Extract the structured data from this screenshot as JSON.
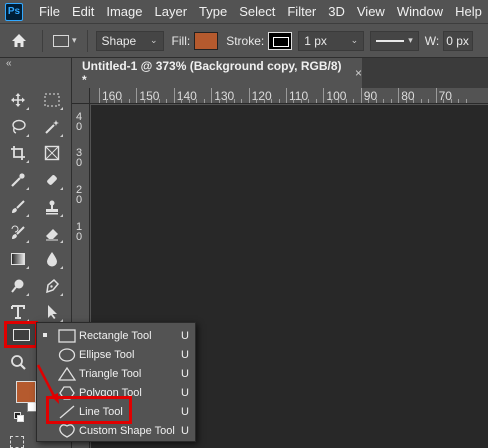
{
  "app": {
    "logo_text": "Ps"
  },
  "menu": [
    "File",
    "Edit",
    "Image",
    "Layer",
    "Type",
    "Select",
    "Filter",
    "3D",
    "View",
    "Window",
    "Help"
  ],
  "options_bar": {
    "mode_value": "Shape",
    "fill_label": "Fill:",
    "stroke_label": "Stroke:",
    "stroke_width_value": "1 px",
    "width_label": "W:",
    "width_value": "0 px",
    "fill_color": "#b55a2e",
    "stroke_color": "#000000"
  },
  "document_tab": {
    "title": "Untitled-1 @ 373% (Background copy, RGB/8) *",
    "close": "×"
  },
  "ruler": {
    "top_labels": [
      "160",
      "150",
      "140",
      "130",
      "120",
      "110",
      "100",
      "90",
      "80",
      "70"
    ],
    "left_labels": [
      "4",
      "0",
      "3",
      "0",
      "2",
      "0",
      "1",
      "0"
    ]
  },
  "toolbar": {
    "collapse": "«",
    "foreground_color": "#b55a2e",
    "background_color": "#ffffff"
  },
  "flyout": {
    "items": [
      {
        "name": "Rectangle Tool",
        "shortcut": "U",
        "icon": "rectangle-icon",
        "selected": true
      },
      {
        "name": "Ellipse Tool",
        "shortcut": "U",
        "icon": "ellipse-icon",
        "selected": false
      },
      {
        "name": "Triangle Tool",
        "shortcut": "U",
        "icon": "triangle-icon",
        "selected": false
      },
      {
        "name": "Polygon Tool",
        "shortcut": "U",
        "icon": "polygon-icon",
        "selected": false
      },
      {
        "name": "Line Tool",
        "shortcut": "U",
        "icon": "line-icon",
        "selected": false
      },
      {
        "name": "Custom Shape Tool",
        "shortcut": "U",
        "icon": "custom-shape-icon",
        "selected": false
      }
    ]
  },
  "annotation_color": "#e00000"
}
